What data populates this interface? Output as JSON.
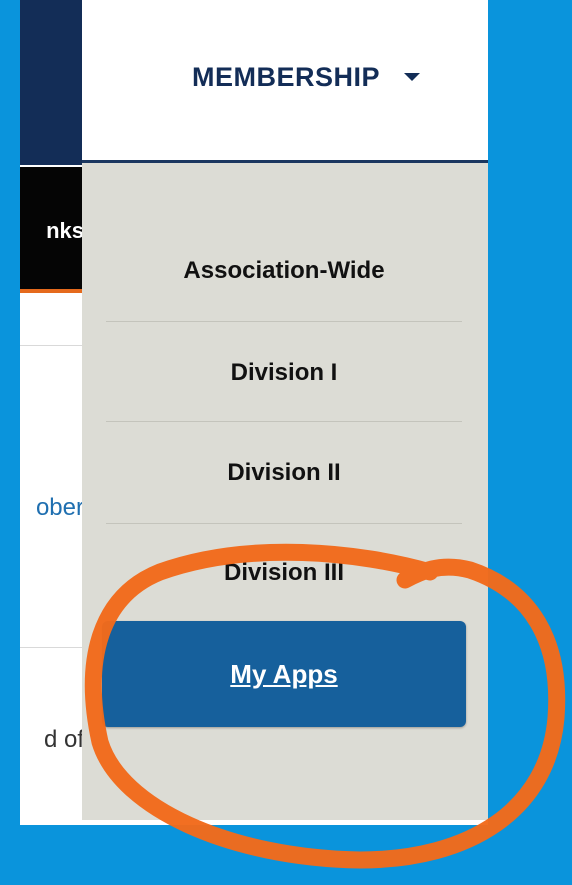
{
  "header": {
    "membership_label": "MEMBERSHIP"
  },
  "left_panel": {
    "links_fragment": "nks",
    "october_fragment": "ober",
    "of_fragment": "d of"
  },
  "dropdown": {
    "items": [
      {
        "label": "Association-Wide"
      },
      {
        "label": "Division I"
      },
      {
        "label": "Division II"
      },
      {
        "label": "Division III"
      }
    ],
    "my_apps_label": "My Apps"
  },
  "colors": {
    "background": "#0a94dc",
    "navy": "#132d57",
    "dropdown_bg": "#dcdcd5",
    "button_blue": "#16609c",
    "annotation_orange": "#f26a1b"
  }
}
